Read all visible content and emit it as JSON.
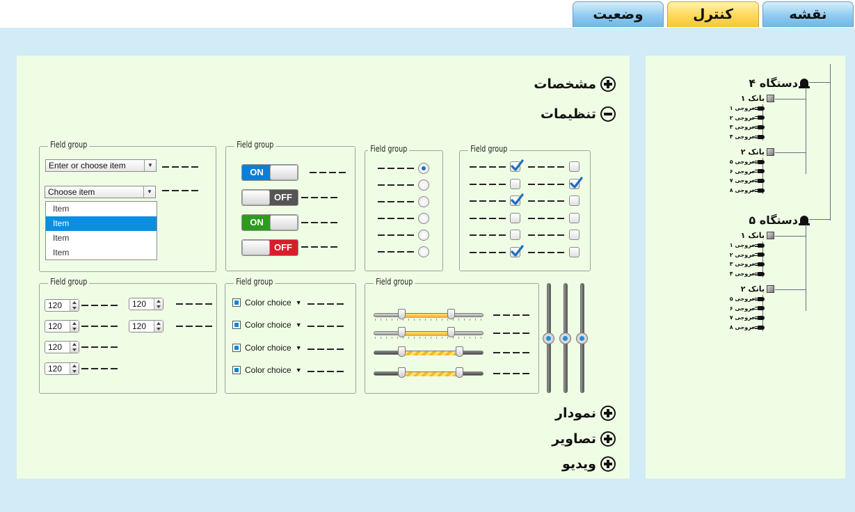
{
  "tabs": [
    {
      "label": "نقشه"
    },
    {
      "label": "کنترل",
      "active": true
    },
    {
      "label": "وضعیت"
    }
  ],
  "accordion": {
    "specs": "مشخصات",
    "settings": "تنظیمات",
    "chart": "نمودار",
    "images": "تصاویر",
    "video": "ویدیو"
  },
  "fieldgroups": {
    "legend": "Field group",
    "combo_value": "Enter or choose item",
    "select_value": "Choose item",
    "list_items": [
      "Item",
      "Item",
      "Item",
      "Item"
    ],
    "list_selected_index": 1,
    "toggles": [
      {
        "on_label": "ON",
        "state": "on",
        "color": "#0a7fd8"
      },
      {
        "off_label": "OFF",
        "state": "off",
        "color": "#555555"
      },
      {
        "on_label": "ON",
        "state": "on",
        "color": "#2e9a1e"
      },
      {
        "off_label": "OFF",
        "state": "off",
        "color": "#d81e2a"
      }
    ],
    "radios": [
      true,
      false,
      false,
      false,
      false,
      false
    ],
    "checks_left": [
      true,
      false,
      true,
      false,
      false,
      true
    ],
    "checks_right": [
      false,
      true,
      false,
      false,
      false,
      false
    ],
    "spinners": [
      "120",
      "120",
      "120",
      "120",
      "120",
      "120"
    ],
    "color_choice": "Color choice",
    "sliders": [
      {
        "low": 0.25,
        "high": 0.7
      },
      {
        "low": 0.25,
        "high": 0.7
      },
      {
        "low": 0.25,
        "high": 0.78
      },
      {
        "low": 0.25,
        "high": 0.78
      }
    ],
    "vsliders": [
      0.5,
      0.5,
      0.5
    ]
  },
  "tree": {
    "devices": [
      {
        "label": "دستگاه ۴",
        "banks": [
          {
            "label": "بانک ۱",
            "outputs": [
              "خروجی ۱",
              "خروجی ۲",
              "خروجی ۳",
              "خروجی ۴"
            ]
          },
          {
            "label": "بانک ۲",
            "outputs": [
              "خروجی ۵",
              "خروجی ۶",
              "خروجی ۷",
              "خروجی ۸"
            ]
          }
        ]
      },
      {
        "label": "دستگاه ۵",
        "banks": [
          {
            "label": "بانک ۱",
            "outputs": [
              "خروجی ۱",
              "خروجی ۲",
              "خروجی ۳",
              "خروجی ۴"
            ]
          },
          {
            "label": "بانک ۲",
            "outputs": [
              "خروجی ۵",
              "خروجی ۶",
              "خروجی ۷",
              "خروجی ۸"
            ]
          }
        ]
      }
    ]
  },
  "colors": {
    "band": "#d1ebf7",
    "panel": "#f0fde5",
    "tab_blue": "#8fcaf0",
    "tab_active": "#ffd85a"
  }
}
